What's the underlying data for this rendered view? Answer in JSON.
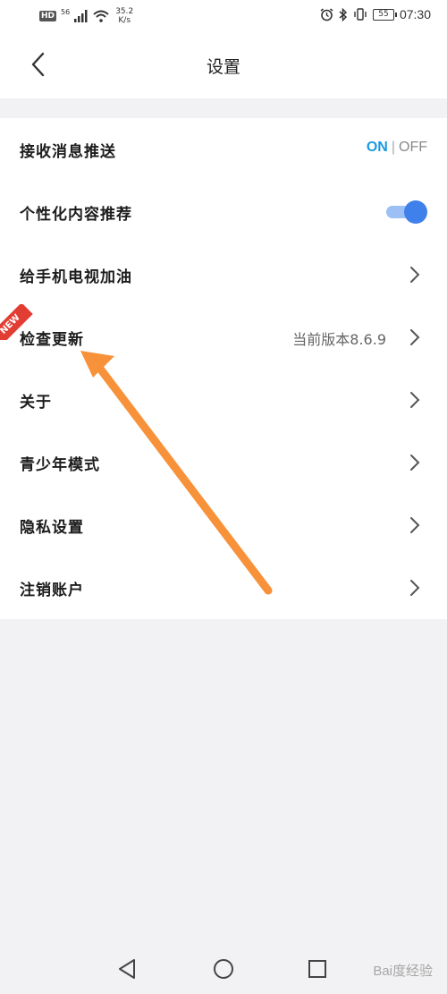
{
  "status_bar": {
    "hd": "HD",
    "network": "56",
    "speed_value": "35.2",
    "speed_unit": "K/s",
    "battery": "55",
    "time": "07:30"
  },
  "header": {
    "title": "设置"
  },
  "settings": {
    "push": {
      "label": "接收消息推送",
      "on": "ON",
      "separator": "|",
      "off": "OFF"
    },
    "personalized": {
      "label": "个性化内容推荐",
      "enabled": true
    },
    "boost": {
      "label": "给手机电视加油"
    },
    "update": {
      "label": "检查更新",
      "badge": "NEW",
      "version": "当前版本8.6.9"
    },
    "about": {
      "label": "关于"
    },
    "youth": {
      "label": "青少年模式"
    },
    "privacy": {
      "label": "隐私设置"
    },
    "logout": {
      "label": "注销账户"
    }
  },
  "colors": {
    "accent": "#1a9be0",
    "toggle": "#3f80ea",
    "badge": "#e23d33",
    "arrow": "#f7923a"
  },
  "watermark": "Bai度经验"
}
